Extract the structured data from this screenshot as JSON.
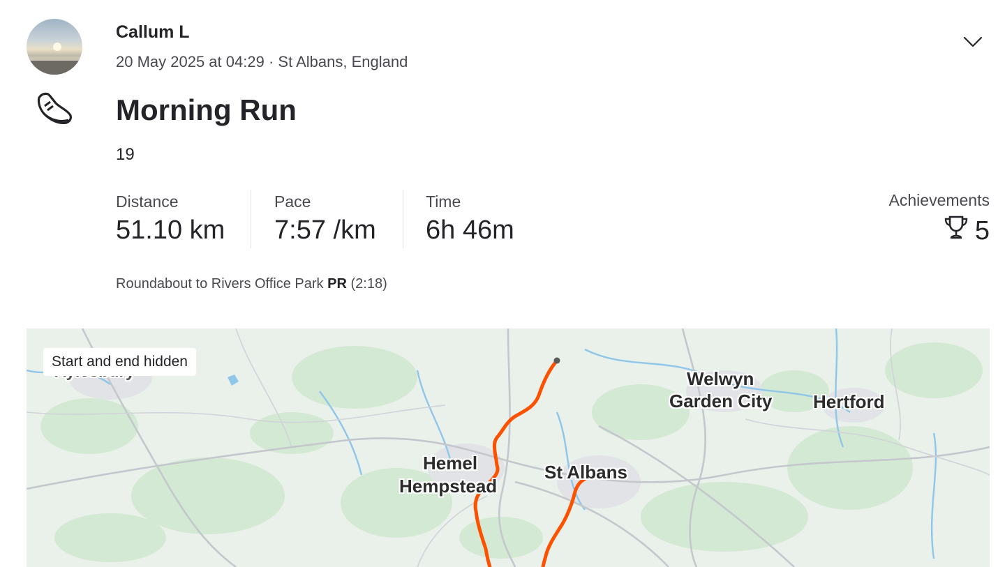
{
  "athlete": {
    "name": "Callum L",
    "datetime": "20 May 2025 at 04:29",
    "location": "St Albans, England"
  },
  "activity": {
    "sport_icon": "running-shoe-icon",
    "title": "Morning Run",
    "description": "19",
    "stats": [
      {
        "label": "Distance",
        "value": "51.10 km"
      },
      {
        "label": "Pace",
        "value": "7:57 /km"
      },
      {
        "label": "Time",
        "value": "6h 46m"
      }
    ],
    "achievements": {
      "label": "Achievements",
      "count": "5",
      "icon": "trophy-icon"
    },
    "segment": {
      "name": "Roundabout to Rivers Office Park",
      "badge": "PR",
      "time": "(2:18)"
    }
  },
  "map": {
    "badge": "Start and end hidden",
    "places": {
      "aylesbury": "Aylesbury",
      "hemel": [
        "Hemel",
        "Hempstead"
      ],
      "st_albans": "St Albans",
      "welwyn": [
        "Welwyn",
        "Garden City"
      ],
      "hertford": "Hertford"
    },
    "route_color": "#fc5200"
  },
  "colors": {
    "text": "#242428",
    "muted": "#494950",
    "route": "#fc5200"
  }
}
